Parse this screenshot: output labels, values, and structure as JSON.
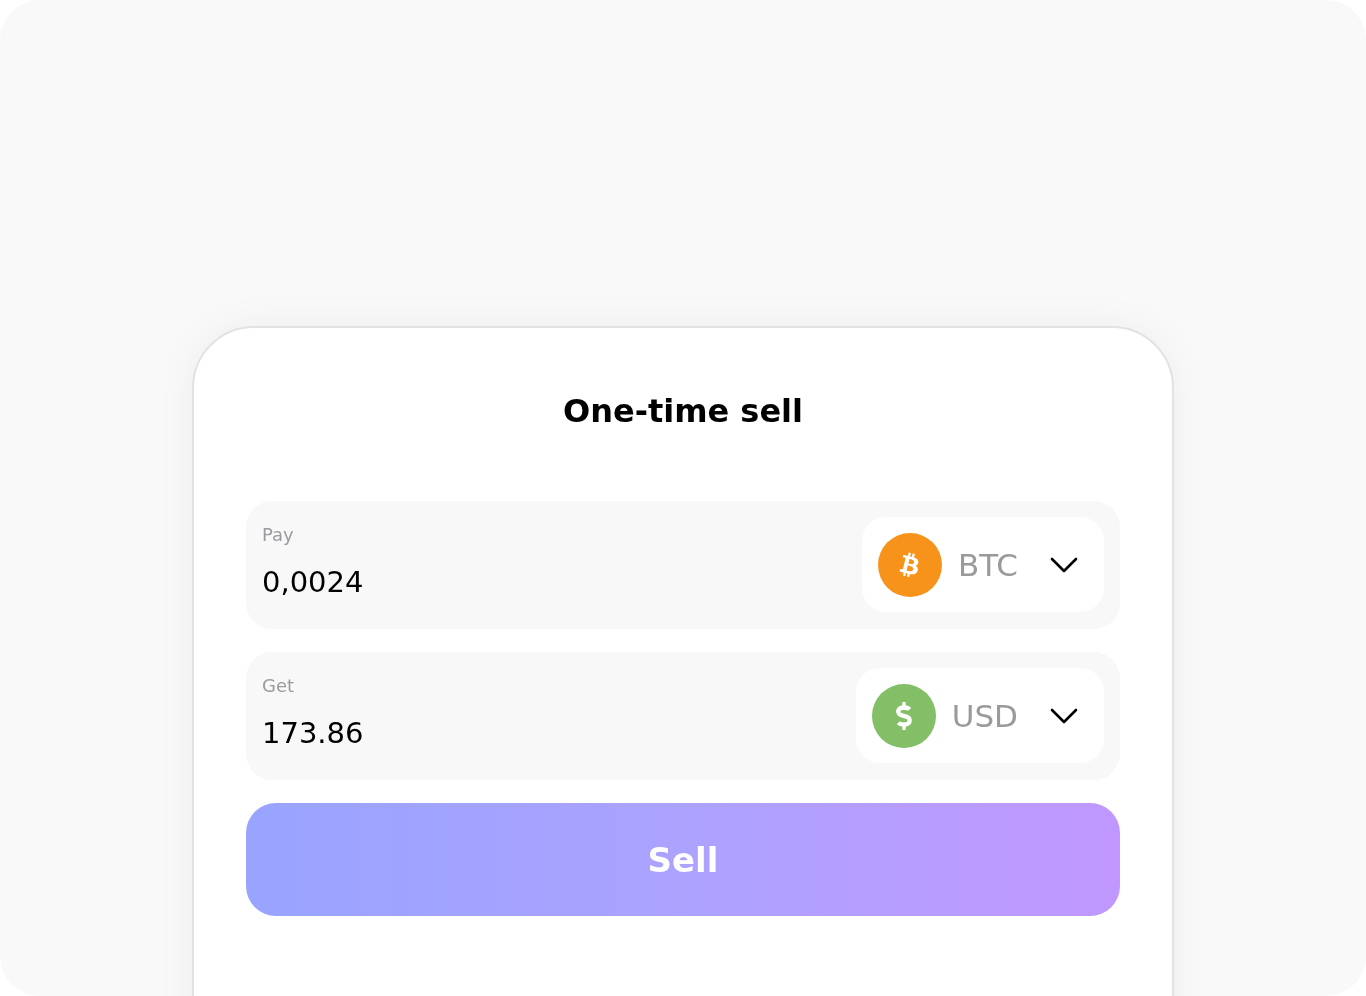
{
  "title": "One-time sell",
  "rows": [
    {
      "label": "Pay",
      "value": "0,0024",
      "currency": {
        "code": "BTC",
        "kind": "bitcoin"
      }
    },
    {
      "label": "Get",
      "value": "173.86",
      "currency": {
        "code": "USD",
        "kind": "dollar"
      }
    }
  ],
  "submit_button": {
    "label": "Sell"
  }
}
